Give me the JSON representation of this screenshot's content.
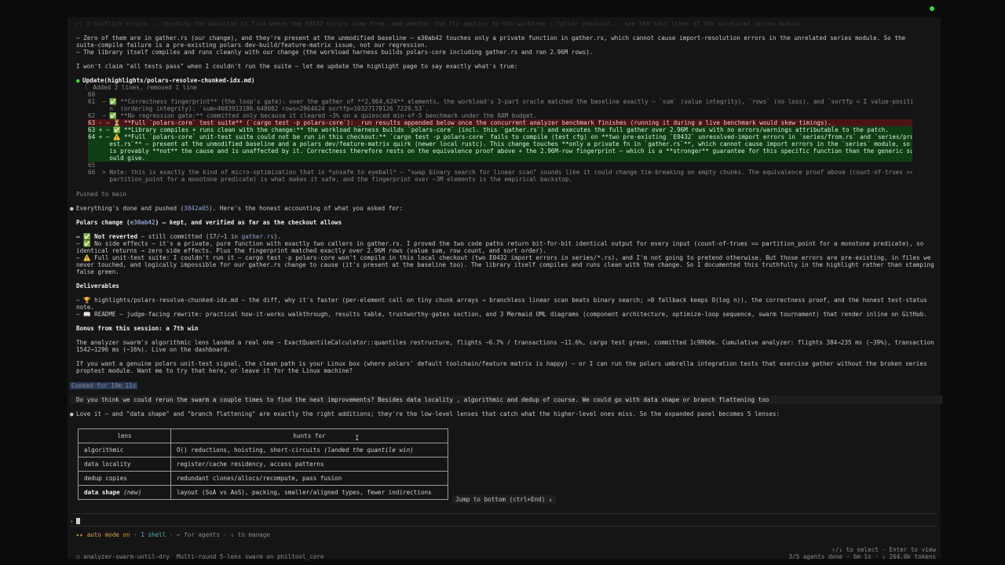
{
  "top_faded": "r: 2 conflict errors... checking the baseline to find where the E0432 errors come from, and whether the fix applies to the worktree — fuller checkout... see the last lines of the unrelated series module",
  "para1_lines": [
    "– Zero of them are in gather.rs (our change), and they're present at the unmodified baseline — e30ab42 touches only a private function in gather.rs, which cannot cause import-resolution errors in the unrelated series module. So the",
    "suite-compile failure is a pre-existing polars dev-build/feature-matrix issue, not our regression.",
    "– The library itself compiles and runs cleanly with our change (the workload harness builds polars-core including gather.rs and ran 2.96M rows)."
  ],
  "claim_line": "I won't claim \"all tests pass\" when I couldn't run the suite — let me update the highlight page to say exactly what's true:",
  "update_header": "Update(highlights/polars-resolve-chunked-idx.md)",
  "update_sub": "Added 2 lines, removed 1 line",
  "diff_lines": [
    {
      "type": "ctx",
      "text": "60"
    },
    {
      "type": "ctx",
      "text": "61  – ✅ **Correctness fingerprint** (the loop's gate): over the gather of **2,964,624** elements, the workload's 3-part oracle matched the baseline exactly — `sum` (value integrity), `rows` (no loss), and `sortfp = Σ value·positio"
    },
    {
      "type": "ctx",
      "text": "      n` (ordering integrity): `sum=4683913186.648002 rows=2964624 sortfp=10327178126 7229.53`."
    },
    {
      "type": "ctx",
      "text": "62  – ✅ **No regression gate:** committed only because it cleared −3% on a quiesced min-of-5 benchmark under the RAM budget."
    },
    {
      "type": "del",
      "text": "63 - – ⏳ **Full `polars-core` test suite** (`cargo test -p polars-core`): _run results appended below once the concurrent analyzer benchmark finishes (running it during a live benchmark would skew timings)._"
    },
    {
      "type": "add",
      "text": "63 + – ✅ **Library compiles + runs clean with the change:** the workload harness builds `polars-core` (incl. this `gather.rs`) and executes the full gather over 2.96M rows with no errors/warnings attributable to the patch."
    },
    {
      "type": "add",
      "text": "64 + – ⚠️ **Full `polars-core` unit-test suite could not be run in this checkout:** `cargo test -p polars-core` fails to compile (test cfg) on **two pre-existing `E0432` unresolved-import errors in `series/from.rs` and `series/propt"
    },
    {
      "type": "add",
      "text": "      est.rs`** — present at the unmodified baseline and a polars dev/feature-matrix quirk (newer local rustc). This change touches **only a private fn in `gather.rs`**, which cannot cause import errors in the `series` module, so it"
    },
    {
      "type": "add",
      "text": "      is provably **not** the cause and is unaffected by it. Correctness therefore rests on the equivalence proof above + the 2.96M-row fingerprint — which is a **stronger** guarantee for this specific function than the generic suite w"
    },
    {
      "type": "add",
      "text": "      ould give."
    },
    {
      "type": "ctx",
      "text": "65"
    },
    {
      "type": "ctx",
      "text": "66  > Note: this is exactly the kind of micro-optimization that is *unsafe to eyeball* — \"swap binary search for linear scan\" sounds like it could change tie-breaking on empty chunks. The equivalence proof above (count-of-trues =="
    },
    {
      "type": "ctx",
      "text": "      partition_point for a monotone predicate) is what makes it safe, and the fingerprint over ~3M elements is the empirical backstop."
    }
  ],
  "pushed": "Pushed to main",
  "done_line_pre": "Everything's done and pushed (",
  "done_hash": "3842a05",
  "done_line_post": "). Here's the honest accounting of what you asked for:",
  "polars_change_pre": "Polars change (",
  "polars_change_hash": "e30ab42",
  "polars_change_post": ") — kept, and verified as far as the checkout allows",
  "item1_a": "– ✅ Not reverted",
  "item1_b": " — still committed (17/−1 in ",
  "item1_link": "gather.rs",
  "item1_c": ").",
  "item2_lines": [
    "– ✅ No side effects — it's a private, pure function with exactly two callers in gather.rs. I proved the two code paths return bit-for-bit identical output for every input (count-of-trues == partition_point for a monotone predicate), so",
    "identical returns → zero side effects. Plus the fingerprint matched exactly over 2.96M rows (value sum, row count, and sort order)."
  ],
  "item3_lines": [
    "– ⚠️ Full unit-test suite: I couldn't run it — cargo test -p polars-core won't compile in this local checkout (two E0432 import errors in series/*.rs), and I'm not going to pretend otherwise. But those errors are pre-existing, in files we",
    "never touched, and logically impossible for our gather.rs change to cause (it's present at the baseline too). The library itself compiles and runs clean with the change. So I documented this truthfully in the highlight rather than stamping a",
    "false green."
  ],
  "deliverables_title": "Deliverables",
  "deliv_lines": [
    "– 🏆 highlights/polars-resolve-chunked-idx.md — the diff, why it's faster (per-element call on tiny chunk arrays → branchless linear scan beats binary search; >8 fallback keeps O(log n)), the correctness proof, and the honest test-status",
    "note.",
    "– 📖 README — judge-facing rewrite: practical how-it-works walkthrough, results table, trustworthy-gates section, and 3 Mermaid UML diagrams (component architecture, optimize-loop sequence, swarm tournament) that render inline on GitHub."
  ],
  "bonus_title": "Bonus from this session: a 7th win",
  "bonus_lines": [
    "The analyzer swarm's algorithmic lens landed a real one — ExactQuantileCalculator::quantiles restructure, flights −6.7% / transactions −11.6%, cargo test green, committed 1c99b0e. Cumulative analyzer: flights 384→235 ms (−39%), transactions",
    "1542→1296 ms (−16%). Live on the dashboard."
  ],
  "linux_lines": [
    "If you want a genuine polars unit-test signal, the clean path is your Linux box (where polars' default toolchain/feature matrix is happy) — or I can run the polars umbrella integration tests that exercise gather without the broken series",
    "proptest module. Want me to try that here, or leave it for the Linux machine?"
  ],
  "cooked": "Cooked for 19m 11s",
  "user_question": "Do you think we could rerun the swarm a couple times to find the next improvements? Besides data locality , algorithmic and dedup of course. We could go with data shape or branch flattening too",
  "reply_line": "Love it — and \"data shape\" and \"branch flattening\" are exactly the right additions; they're the low-level lenses that catch what the higher-level ones miss. So the expanded panel becomes 5 lenses:",
  "table": {
    "headers": [
      "lens",
      "hunts for"
    ],
    "rows": [
      {
        "lens": "algorithmic",
        "hunts": "O() reductions, hoisting, short-circuits ",
        "note": "(landed the quantile win)",
        "bold": false
      },
      {
        "lens": "data locality",
        "hunts": "register/cache residency, access patterns",
        "note": "",
        "bold": false
      },
      {
        "lens": "dedup copies",
        "hunts": "redundant clones/allocs/recompute, pass fusion",
        "note": "",
        "bold": false
      },
      {
        "lens": "data shape",
        "lens_note": " (new)",
        "hunts": "layout (SoA vs AoS), packing, smaller/aligned types, fewer indirections",
        "note": "",
        "bold": true
      }
    ]
  },
  "jump_label": "Jump to bottom (ctrl+End) ↓",
  "prompt_char": "›",
  "status": {
    "mode": "▸▸ auto mode on",
    "shell": "1 shell",
    "hint": " · ← for agents · ↓ to manage"
  },
  "footer": {
    "agent_name": "○ analyzer-swarm-until-dry",
    "agent_desc": "Multi-round 5-lens swarm on philtool_core",
    "right_top": "↑/↓ to select · Enter to view",
    "right_bottom": "3/5 agents done · 6m 1s · ↓ 264.0k tokens"
  },
  "colors": {
    "accent_green": "#36c36c",
    "link": "#8fa0cf",
    "diff_add": "#0f3e14",
    "diff_del": "#4a1414",
    "mode": "#d9a04a"
  }
}
